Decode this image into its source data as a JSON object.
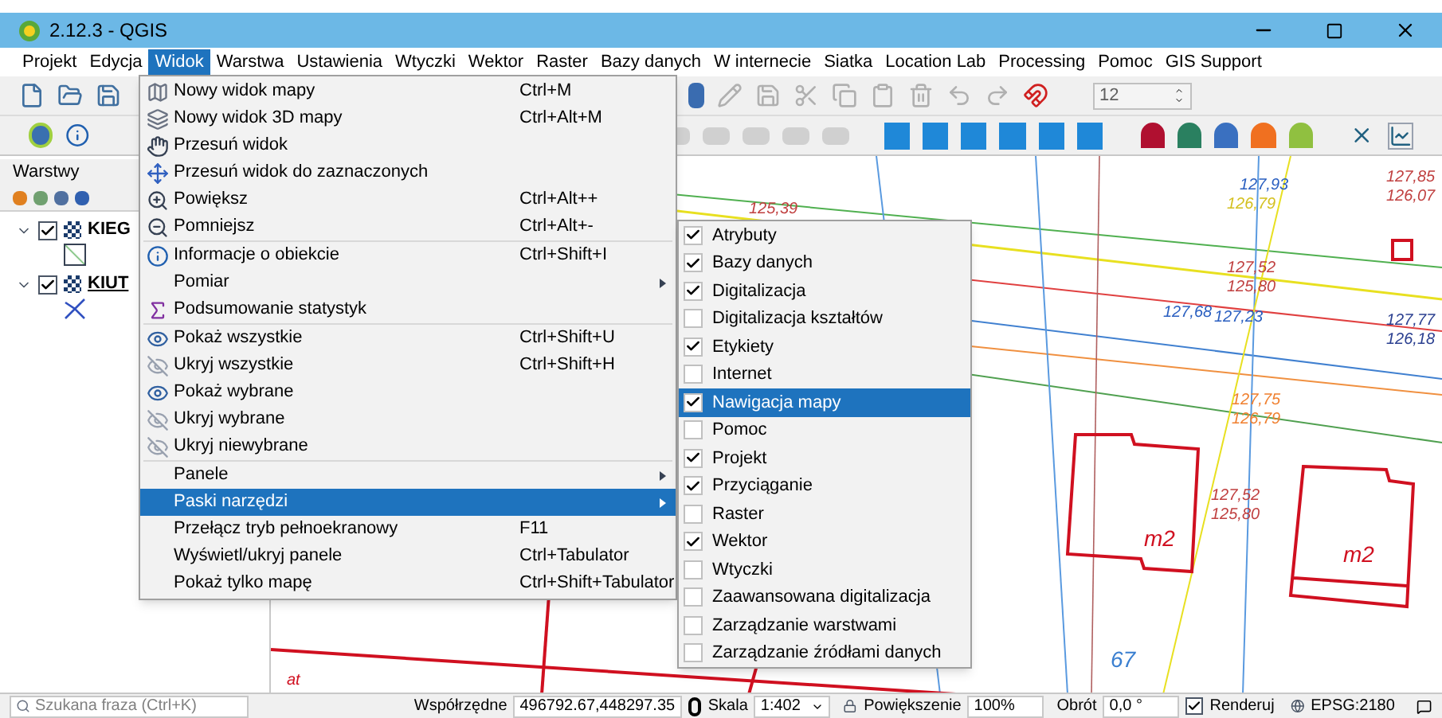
{
  "window": {
    "title": "2.12.3 - QGIS"
  },
  "menu_bar": [
    {
      "label": "Projekt",
      "selected": false
    },
    {
      "label": "Edycja",
      "selected": false
    },
    {
      "label": "Widok",
      "selected": true
    },
    {
      "label": "Warstwa",
      "selected": false
    },
    {
      "label": "Ustawienia",
      "selected": false
    },
    {
      "label": "Wtyczki",
      "selected": false
    },
    {
      "label": "Wektor",
      "selected": false
    },
    {
      "label": "Raster",
      "selected": false
    },
    {
      "label": "Bazy danych",
      "selected": false
    },
    {
      "label": "W internecie",
      "selected": false
    },
    {
      "label": "Siatka",
      "selected": false
    },
    {
      "label": "Location Lab",
      "selected": false
    },
    {
      "label": "Processing",
      "selected": false
    },
    {
      "label": "Pomoc",
      "selected": false
    },
    {
      "label": "GIS Support",
      "selected": false
    }
  ],
  "toolbar": {
    "snapping_value": "12"
  },
  "layers_panel": {
    "title": "Warstwy",
    "layers": [
      {
        "name": "KIEG",
        "checked": true,
        "expanded": true,
        "kind": "polygon"
      },
      {
        "name": "KIUT",
        "checked": true,
        "expanded": true,
        "kind": "line"
      }
    ]
  },
  "view_menu": {
    "items": [
      {
        "kind": "item",
        "label": "Nowy widok mapy",
        "shortcut": "Ctrl+M",
        "selected": false
      },
      {
        "kind": "item",
        "label": "Nowy widok 3D mapy",
        "shortcut": "Ctrl+Alt+M",
        "selected": false
      },
      {
        "kind": "item",
        "label": "Przesuń widok",
        "selected": false
      },
      {
        "kind": "item",
        "label": "Przesuń widok do zaznaczonych",
        "selected": false
      },
      {
        "kind": "item",
        "label": "Powiększ",
        "shortcut": "Ctrl+Alt++",
        "selected": false
      },
      {
        "kind": "item",
        "label": "Pomniejsz",
        "shortcut": "Ctrl+Alt+-",
        "selected": false
      },
      {
        "kind": "separator"
      },
      {
        "kind": "item",
        "label": "Informacje o obiekcie",
        "shortcut": "Ctrl+Shift+I",
        "selected": false
      },
      {
        "kind": "submenu",
        "label": "Pomiar",
        "selected": false
      },
      {
        "kind": "item",
        "label": "Podsumowanie statystyk",
        "selected": false
      },
      {
        "kind": "separator"
      },
      {
        "kind": "item",
        "label": "Pokaż wszystkie",
        "shortcut": "Ctrl+Shift+U",
        "selected": false
      },
      {
        "kind": "item",
        "label": "Ukryj wszystkie",
        "shortcut": "Ctrl+Shift+H",
        "selected": false
      },
      {
        "kind": "item",
        "label": "Pokaż wybrane",
        "selected": false
      },
      {
        "kind": "item",
        "label": "Ukryj wybrane",
        "selected": false
      },
      {
        "kind": "item",
        "label": "Ukryj niewybrane",
        "selected": false
      },
      {
        "kind": "separator"
      },
      {
        "kind": "submenu",
        "label": "Panele",
        "selected": false
      },
      {
        "kind": "submenu",
        "label": "Paski narzędzi",
        "selected": true
      },
      {
        "kind": "item",
        "label": "Przełącz tryb pełnoekranowy",
        "shortcut": "F11",
        "selected": false
      },
      {
        "kind": "item",
        "label": "Wyświetl/ukryj panele",
        "shortcut": "Ctrl+Tabulator",
        "selected": false
      },
      {
        "kind": "item",
        "label": "Pokaż tylko mapę",
        "shortcut": "Ctrl+Shift+Tabulator",
        "selected": false
      }
    ]
  },
  "toolbars_submenu": {
    "items": [
      {
        "label": "Atrybuty",
        "checked": true,
        "selected": false
      },
      {
        "label": "Bazy danych",
        "checked": true,
        "selected": false
      },
      {
        "label": "Digitalizacja",
        "checked": true,
        "selected": false
      },
      {
        "label": "Digitalizacja kształtów",
        "checked": false,
        "selected": false
      },
      {
        "label": "Etykiety",
        "checked": true,
        "selected": false
      },
      {
        "label": "Internet",
        "checked": false,
        "selected": false
      },
      {
        "label": "Nawigacja mapy",
        "checked": true,
        "selected": true
      },
      {
        "label": "Pomoc",
        "checked": false,
        "selected": false
      },
      {
        "label": "Projekt",
        "checked": true,
        "selected": false
      },
      {
        "label": "Przyciąganie",
        "checked": true,
        "selected": false
      },
      {
        "label": "Raster",
        "checked": false,
        "selected": false
      },
      {
        "label": "Wektor",
        "checked": true,
        "selected": false
      },
      {
        "label": "Wtyczki",
        "checked": false,
        "selected": false
      },
      {
        "label": "Zaawansowana digitalizacja",
        "checked": false,
        "selected": false
      },
      {
        "label": "Zarządzanie warstwami",
        "checked": false,
        "selected": false
      },
      {
        "label": "Zarządzanie źródłami danych",
        "checked": false,
        "selected": false
      }
    ]
  },
  "map": {
    "labels": [
      {
        "text": "125,39",
        "color": "#c04040"
      },
      {
        "text": "127,93",
        "color": "#2a5fc0"
      },
      {
        "text": "126,79",
        "color": "#d4c020"
      },
      {
        "text": "127,85",
        "color": "#c04040"
      },
      {
        "text": "126,07",
        "color": "#c04040"
      },
      {
        "text": "127,52",
        "color": "#c04040"
      },
      {
        "text": "125,80",
        "color": "#c04040"
      },
      {
        "text": "127,68",
        "color": "#2a5fc0"
      },
      {
        "text": "127,23",
        "color": "#2a5fc0"
      },
      {
        "text": "127,77",
        "color": "#2a3f90"
      },
      {
        "text": "126,18",
        "color": "#2a3f90"
      },
      {
        "text": "127,75",
        "color": "#f08030"
      },
      {
        "text": "126,79",
        "color": "#f08030"
      },
      {
        "text": "127,52",
        "color": "#c04040"
      },
      {
        "text": "125,80",
        "color": "#c04040"
      },
      {
        "text": "m2",
        "color": "#d01020"
      },
      {
        "text": "m2",
        "color": "#d01020"
      },
      {
        "text": "67",
        "color": "#3a7fd0"
      },
      {
        "text": "at",
        "color": "#d01020"
      }
    ]
  },
  "status_bar": {
    "search_placeholder": "Szukana fraza (Ctrl+K)",
    "coordinate_label": "Współrzędne",
    "coordinate_value": "496792.67,448297.35",
    "scale_label": "Skala",
    "scale_value": "1:402",
    "magnifier_label": "Powiększenie",
    "magnifier_value": "100%",
    "rotation_label": "Obrót",
    "rotation_value": "0,0 °",
    "render_label": "Renderuj",
    "render_checked": true,
    "crs": "EPSG:2180"
  }
}
